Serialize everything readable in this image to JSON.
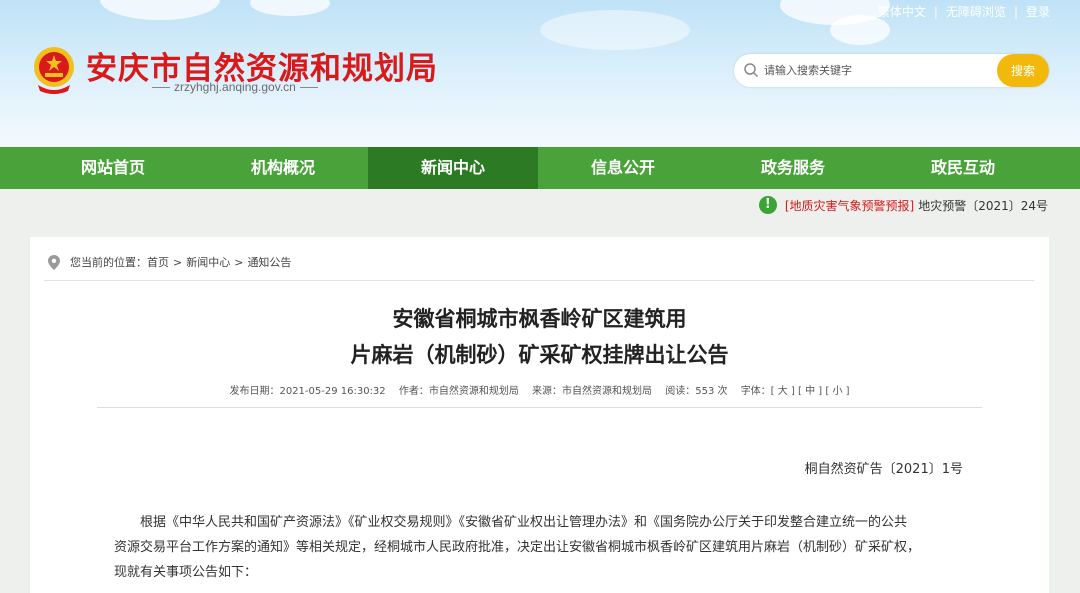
{
  "header": {
    "site_title": "安庆市自然资源和规划局",
    "site_domain": "zrzyhghj.anqing.gov.cn",
    "top_links": [
      "繁体中文",
      "无障碍浏览",
      "登录"
    ],
    "search": {
      "placeholder": "请输入搜索关键字",
      "button_label": "搜索"
    }
  },
  "nav": {
    "items": [
      "网站首页",
      "机构概况",
      "新闻中心",
      "信息公开",
      "政务服务",
      "政民互动"
    ],
    "active_index": 2
  },
  "alert": {
    "icon_glyph": "!",
    "tag": "[地质灾害气象预警预报]",
    "text": "地灾预警〔2021〕24号"
  },
  "breadcrumb": {
    "prefix": "您当前的位置：",
    "items": [
      "首页",
      "新闻中心",
      "通知公告"
    ],
    "separator": ">"
  },
  "article": {
    "title_lines": [
      "安徽省桐城市枫香岭矿区建筑用",
      "片麻岩（机制砂）矿采矿权挂牌出让公告"
    ],
    "meta": {
      "date": "发布日期：2021-05-29 16:30:32",
      "author": "作者：市自然资源和规划局",
      "source": "来源：市自然资源和规划局",
      "views": "阅读：553 次",
      "font_size": "字体：[ 大 ] [ 中 ] [ 小 ]"
    },
    "doc_number": "桐自然资矿告〔2021〕1号",
    "paragraph_lines": [
      "根据《中华人民共和国矿产资源法》《矿业权交易规则》《安徽省矿业权出让管理办法》和《国务院办公厅关于印发整合建立统一的公共",
      "资源交易平台工作方案的通知》等相关规定，经桐城市人民政府批准，决定出让安徽省桐城市枫香岭矿区建筑用片麻岩（机制砂）矿采矿权，",
      "现就有关事项公告如下："
    ]
  },
  "colors": {
    "brand_red": "#d9191a",
    "nav_green": "#4aa23a",
    "nav_active": "#2d7a24",
    "search_yellow": "#f2b90c"
  }
}
